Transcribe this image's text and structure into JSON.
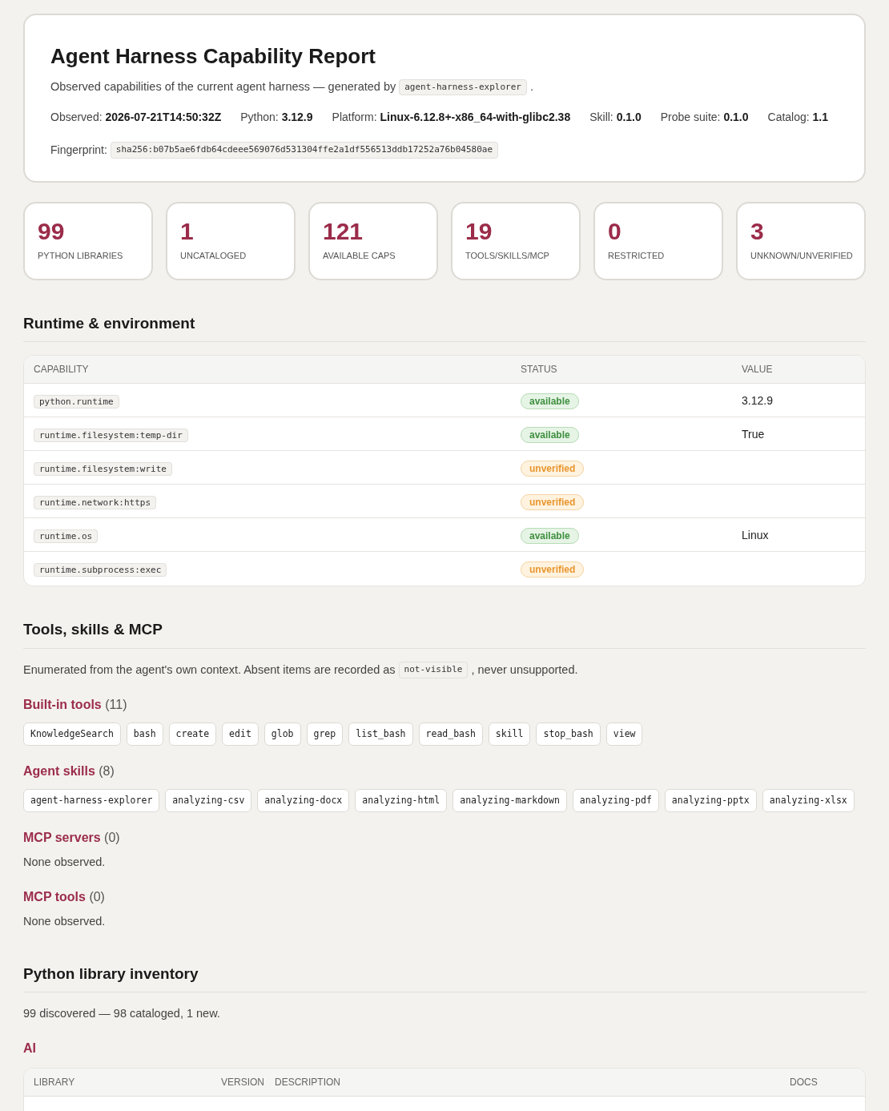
{
  "header": {
    "title": "Agent Harness Capability Report",
    "subtitle": "Observed capabilities of the current agent harness — generated by",
    "generator": "agent-harness-explorer",
    "subtitle_end": ".",
    "meta": [
      {
        "label": "Observed:",
        "value": "2026-07-21T14:50:32Z"
      },
      {
        "label": "Python:",
        "value": "3.12.9"
      },
      {
        "label": "Platform:",
        "value": "Linux-6.12.8+-x86_64-with-glibc2.38"
      },
      {
        "label": "Skill:",
        "value": "0.1.0"
      },
      {
        "label": "Probe suite:",
        "value": "0.1.0"
      },
      {
        "label": "Catalog:",
        "value": "1.1"
      }
    ],
    "fingerprint_label": "Fingerprint:",
    "fingerprint": "sha256:b07b5ae6fdb64cdeee569076d531304ffe2a1df556513ddb17252a76b04580ae"
  },
  "stats": [
    {
      "value": "99",
      "label": "PYTHON LIBRARIES"
    },
    {
      "value": "1",
      "label": "UNCATALOGED"
    },
    {
      "value": "121",
      "label": "AVAILABLE CAPS"
    },
    {
      "value": "19",
      "label": "TOOLS/SKILLS/MCP"
    },
    {
      "value": "0",
      "label": "RESTRICTED"
    },
    {
      "value": "3",
      "label": "UNKNOWN/UNVERIFIED"
    }
  ],
  "runtime": {
    "title": "Runtime & environment",
    "columns": [
      "CAPABILITY",
      "STATUS",
      "VALUE"
    ],
    "rows": [
      {
        "capability": "python.runtime",
        "status": "available",
        "kind": "available",
        "value": "3.12.9"
      },
      {
        "capability": "runtime.filesystem:temp-dir",
        "status": "available",
        "kind": "available",
        "value": "True"
      },
      {
        "capability": "runtime.filesystem:write",
        "status": "unverified",
        "kind": "unverified"
      },
      {
        "capability": "runtime.network:https",
        "status": "unverified",
        "kind": "unverified"
      },
      {
        "capability": "runtime.os",
        "status": "available",
        "kind": "available",
        "value": "Linux"
      },
      {
        "capability": "runtime.subprocess:exec",
        "status": "unverified",
        "kind": "unverified"
      }
    ]
  },
  "tools": {
    "title": "Tools, skills & MCP",
    "intro_before": "Enumerated from the agent's own context. Absent items are recorded as",
    "intro_code": "not-visible",
    "intro_after": ", never unsupported.",
    "groups": [
      {
        "title": "Built-in tools",
        "count": "(11)",
        "items": [
          "KnowledgeSearch",
          "bash",
          "create",
          "edit",
          "glob",
          "grep",
          "list_bash",
          "read_bash",
          "skill",
          "stop_bash",
          "view"
        ]
      },
      {
        "title": "Agent skills",
        "count": "(8)",
        "items": [
          "agent-harness-explorer",
          "analyzing-csv",
          "analyzing-docx",
          "analyzing-html",
          "analyzing-markdown",
          "analyzing-pdf",
          "analyzing-pptx",
          "analyzing-xlsx"
        ]
      },
      {
        "title": "MCP servers",
        "count": "(0)",
        "empty": "None observed."
      },
      {
        "title": "MCP tools",
        "count": "(0)",
        "empty": "None observed."
      }
    ]
  },
  "inventory": {
    "title": "Python library inventory",
    "summary": "99 discovered — 98 cataloged, 1 new.",
    "category": "AI",
    "columns": [
      "LIBRARY",
      "VERSION",
      "DESCRIPTION",
      "DOCS"
    ]
  }
}
